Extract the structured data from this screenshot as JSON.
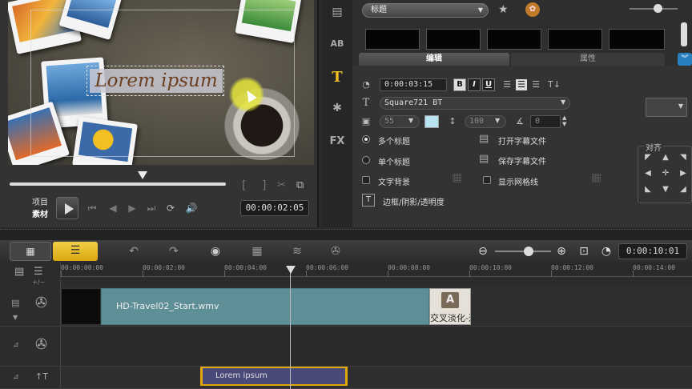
{
  "preview": {
    "title_text": "Lorem ipsum",
    "timecode": "00:00:02:05",
    "mode_project": "项目",
    "mode_clip": "素材",
    "bracket_in": "[",
    "bracket_out": "]"
  },
  "options": {
    "title_dropdown": "标题",
    "tabs": {
      "edit": "编辑",
      "attributes": "属性"
    },
    "duration": "0:00:03:15",
    "format_bold": "B",
    "format_italic": "I",
    "format_underline": "U",
    "font": "Square721 BT",
    "font_size": "55",
    "line_spacing": "100",
    "angle": "0",
    "multi_title": "多个标题",
    "single_title": "单个标题",
    "text_background": "文字背景",
    "border_shadow": "边框/阴影/透明度",
    "open_subtitle": "打开字幕文件",
    "save_subtitle": "保存字幕文件",
    "show_grid": "显示网格线",
    "align_label": "对齐",
    "swatch_color": "#b8e4f2"
  },
  "timeline": {
    "total_timecode": "0:00:10:01",
    "ruler": [
      "00:00:00:00",
      "00:00:02:00",
      "00:00:04:00",
      "00:00:06:00",
      "00:00:08:00",
      "00:00:10:00",
      "00:00:12:00",
      "00:00:14:00"
    ],
    "video_clip": "HD-Travel02_Start.wmv",
    "transition_clip": "交叉淡化-过",
    "transition_badge": "A",
    "title_clip": "Lorem ipsum",
    "track_toggle": "+/−",
    "title_track_label": "↑T",
    "accent": "#e0a80a"
  }
}
